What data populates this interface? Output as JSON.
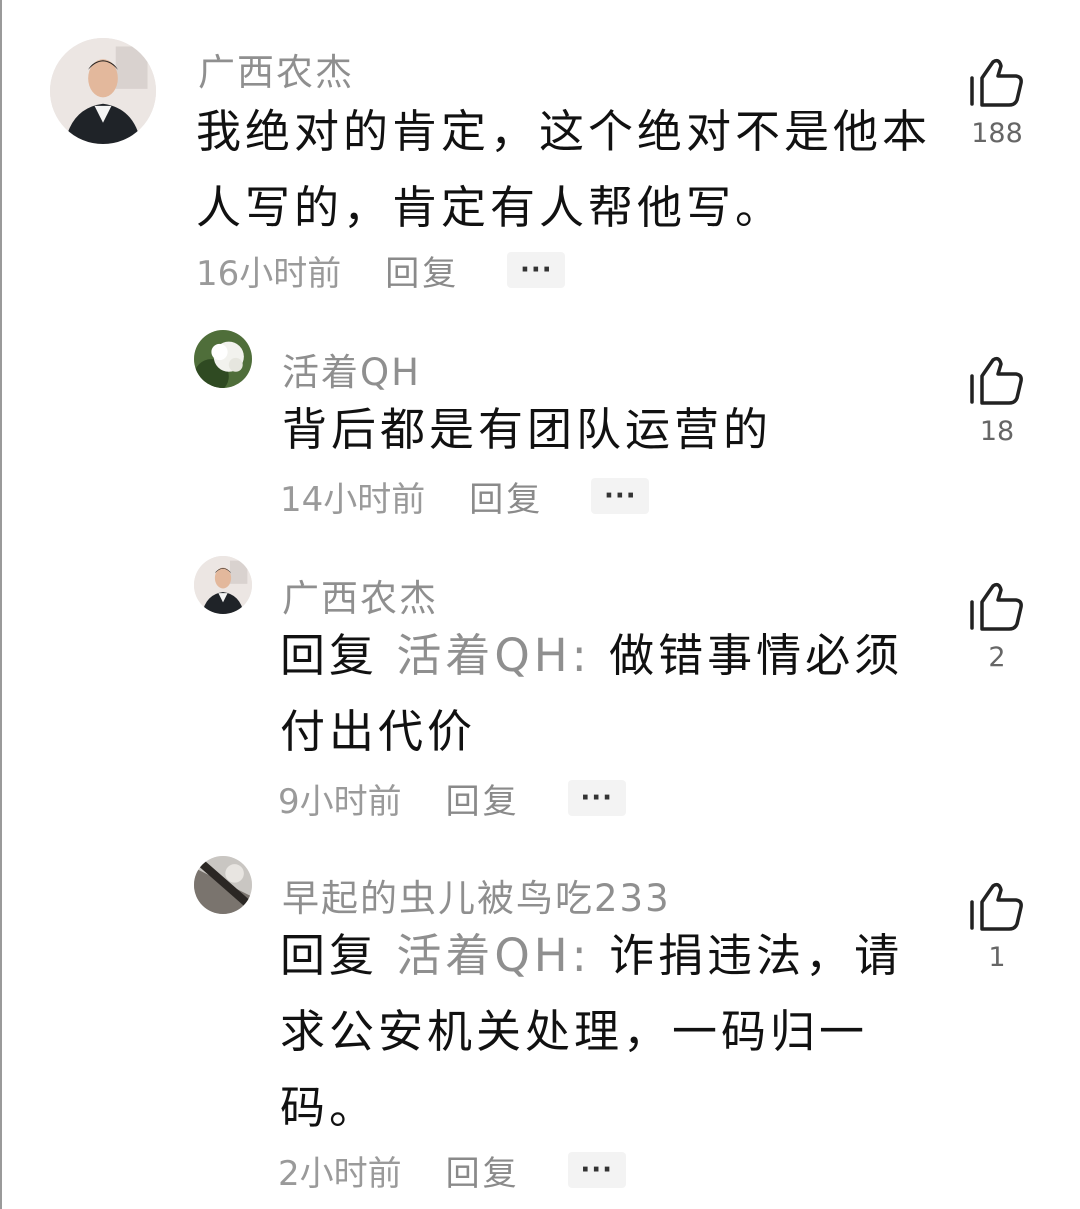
{
  "comments": [
    {
      "username": "广西农杰",
      "text": "我绝对的肯定，这个绝对不是他本人写的，肯定有人帮他写。",
      "time": "16小时前",
      "reply_label": "回复",
      "more_label": "···",
      "likes": "188",
      "avatar": "person-photo"
    },
    {
      "username": "活着QH",
      "text": "背后都是有团队运营的",
      "time": "14小时前",
      "reply_label": "回复",
      "more_label": "···",
      "likes": "18",
      "avatar": "flower-photo"
    },
    {
      "username": "广西农杰",
      "reply_prefix": "回复",
      "mention": "活着QH:",
      "text": "做错事情必须付出代价",
      "time": "9小时前",
      "reply_label": "回复",
      "more_label": "···",
      "likes": "2",
      "avatar": "person-photo"
    },
    {
      "username": "早起的虫儿被鸟吃233",
      "reply_prefix": "回复",
      "mention": "活着QH:",
      "text": "诈捐违法，请求公安机关处理，一码归一码。",
      "time": "2小时前",
      "reply_label": "回复",
      "more_label": "···",
      "likes": "1",
      "avatar": "dark-photo"
    }
  ],
  "icons": {
    "like": "thumbs-up-icon"
  },
  "colors": {
    "muted": "#8f8f8f",
    "text": "#111111",
    "more_bg": "#f3f3f3"
  }
}
